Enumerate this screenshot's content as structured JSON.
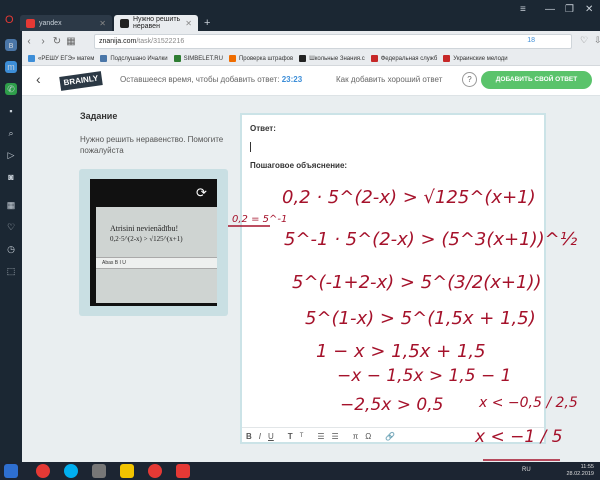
{
  "tabs": [
    {
      "label": "yandex",
      "color": "#e53935"
    },
    {
      "label": "Нужно решить неравен",
      "color": "#222222"
    }
  ],
  "address": {
    "domain": "znanija.com",
    "path": "/task/31522216",
    "count": "18"
  },
  "bookmarks": [
    "«РЕШУ ЕГЭ» матем",
    "Подслушано Ичалки",
    "SIMBELET.RU",
    "Проверка штрафов",
    "Школьные Знания.c",
    "Федеральная служб",
    "Украинские мелоди"
  ],
  "header": {
    "brand": "BRAINLY",
    "timer_label": "Оставшееся время, чтобы добавить ответ:",
    "timer_value": "23:23",
    "howto_link": "Как добавить хороший ответ",
    "help_icon": "?",
    "add_answer_button": "ДОБАВИТЬ СВОЙ ОТВЕТ",
    "accent": "#5ac36b"
  },
  "task": {
    "title": "Задание",
    "text": "Нужно решить неравенство. Помогите пожалуйста",
    "photo_line1": "Atrisini nevienādību!",
    "photo_line2": "0,2·5^(2-x) > √125^(x+1)",
    "photo_toolbar": "Abas    B I U"
  },
  "answer": {
    "answer_label": "Ответ:",
    "explanation_label": "Пошаговое объяснение:",
    "toolbar": [
      "B",
      "I",
      "U",
      "T",
      "T",
      "☰",
      "☰",
      "π",
      "Ω",
      "🔗"
    ]
  },
  "handwriting": {
    "line1": "0,2 · 5^(2-x) > √125^(x+1)",
    "side_note": "0,2 = 5^-1",
    "line2": "5^-1 · 5^(2-x) > (5^3(x+1))^½",
    "line3": "5^(-1+2-x) > 5^(3/2(x+1))",
    "line4": "5^(1-x) > 5^(1,5x + 1,5)",
    "line5": "1 − x > 1,5x + 1,5",
    "line6": "−x − 1,5x > 1,5 − 1",
    "line7": "−2,5x > 0,5",
    "line8": "x < −0,5 / 2,5",
    "line9": "x < −1 / 5"
  },
  "taskbar": {
    "lang": "RU",
    "time": "11:55",
    "date": "28.02.2019"
  }
}
